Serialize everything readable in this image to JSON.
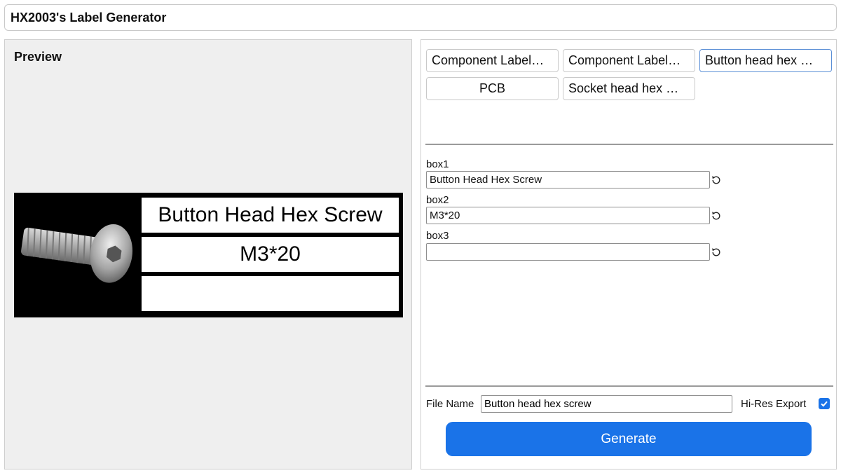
{
  "app": {
    "title": "HX2003's Label Generator"
  },
  "preview": {
    "title": "Preview",
    "label": {
      "box1": "Button Head Hex Screw",
      "box2": "M3*20",
      "box3": ""
    }
  },
  "templates": [
    {
      "label": "Component Label…"
    },
    {
      "label": "Component Label…"
    },
    {
      "label": "Button head hex …",
      "active": true
    },
    {
      "label": "PCB"
    },
    {
      "label": "Socket head hex …"
    }
  ],
  "fields": [
    {
      "label": "box1",
      "value": "Button Head Hex Screw"
    },
    {
      "label": "box2",
      "value": "M3*20"
    },
    {
      "label": "box3",
      "value": ""
    }
  ],
  "export": {
    "file_name_label": "File Name",
    "file_name_value": "Button head hex screw",
    "hires_label": "Hi-Res Export",
    "hires_checked": true,
    "generate_label": "Generate"
  },
  "colors": {
    "accent": "#1a73e8",
    "label_bg": "#000000",
    "panel_bg": "#efefef"
  },
  "icons": {
    "reset": "rotate-ccw-icon",
    "check": "checkmark-icon"
  }
}
